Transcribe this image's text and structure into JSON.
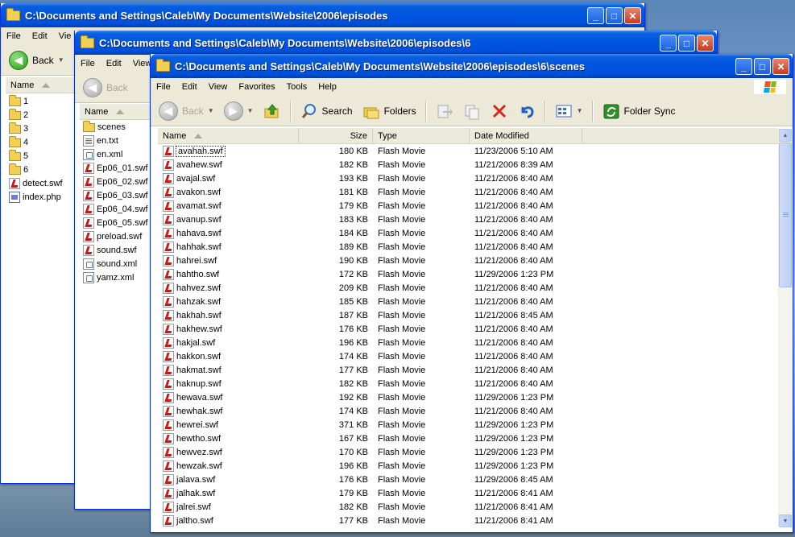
{
  "window1": {
    "title": "C:\\Documents and Settings\\Caleb\\My Documents\\Website\\2006\\episodes",
    "menu": [
      "File",
      "Edit",
      "Vie"
    ],
    "back_label": "Back",
    "name_header": "Name",
    "items": [
      {
        "name": "1",
        "icon": "folder"
      },
      {
        "name": "2",
        "icon": "folder"
      },
      {
        "name": "3",
        "icon": "folder"
      },
      {
        "name": "4",
        "icon": "folder"
      },
      {
        "name": "5",
        "icon": "folder"
      },
      {
        "name": "6",
        "icon": "folder"
      },
      {
        "name": "detect.swf",
        "icon": "swf"
      },
      {
        "name": "index.php",
        "icon": "php"
      }
    ]
  },
  "window2": {
    "title": "C:\\Documents and Settings\\Caleb\\My Documents\\Website\\2006\\episodes\\6",
    "menu": [
      "File",
      "Edit",
      "View"
    ],
    "back_label": "Back",
    "name_header": "Name",
    "items": [
      {
        "name": "scenes",
        "icon": "folder"
      },
      {
        "name": "en.txt",
        "icon": "txt"
      },
      {
        "name": "en.xml",
        "icon": "xml"
      },
      {
        "name": "Ep06_01.swf",
        "icon": "swf"
      },
      {
        "name": "Ep06_02.swf",
        "icon": "swf"
      },
      {
        "name": "Ep06_03.swf",
        "icon": "swf"
      },
      {
        "name": "Ep06_04.swf",
        "icon": "swf"
      },
      {
        "name": "Ep06_05.swf",
        "icon": "swf"
      },
      {
        "name": "preload.swf",
        "icon": "swf"
      },
      {
        "name": "sound.swf",
        "icon": "swf"
      },
      {
        "name": "sound.xml",
        "icon": "xml"
      },
      {
        "name": "yamz.xml",
        "icon": "xml"
      }
    ]
  },
  "window3": {
    "title": "C:\\Documents and Settings\\Caleb\\My Documents\\Website\\2006\\episodes\\6\\scenes",
    "menu": [
      "File",
      "Edit",
      "View",
      "Favorites",
      "Tools",
      "Help"
    ],
    "toolbar": {
      "back": "Back",
      "search": "Search",
      "folders": "Folders",
      "folder_sync": "Folder Sync"
    },
    "columns": {
      "name": "Name",
      "size": "Size",
      "type": "Type",
      "date": "Date Modified"
    },
    "files": [
      {
        "name": "avahah.swf",
        "size": "180 KB",
        "type": "Flash Movie",
        "date": "11/23/2006 5:10 AM"
      },
      {
        "name": "avahew.swf",
        "size": "182 KB",
        "type": "Flash Movie",
        "date": "11/21/2006 8:39 AM"
      },
      {
        "name": "avajal.swf",
        "size": "193 KB",
        "type": "Flash Movie",
        "date": "11/21/2006 8:40 AM"
      },
      {
        "name": "avakon.swf",
        "size": "181 KB",
        "type": "Flash Movie",
        "date": "11/21/2006 8:40 AM"
      },
      {
        "name": "avamat.swf",
        "size": "179 KB",
        "type": "Flash Movie",
        "date": "11/21/2006 8:40 AM"
      },
      {
        "name": "avanup.swf",
        "size": "183 KB",
        "type": "Flash Movie",
        "date": "11/21/2006 8:40 AM"
      },
      {
        "name": "hahava.swf",
        "size": "184 KB",
        "type": "Flash Movie",
        "date": "11/21/2006 8:40 AM"
      },
      {
        "name": "hahhak.swf",
        "size": "189 KB",
        "type": "Flash Movie",
        "date": "11/21/2006 8:40 AM"
      },
      {
        "name": "hahrei.swf",
        "size": "190 KB",
        "type": "Flash Movie",
        "date": "11/21/2006 8:40 AM"
      },
      {
        "name": "hahtho.swf",
        "size": "172 KB",
        "type": "Flash Movie",
        "date": "11/29/2006 1:23 PM"
      },
      {
        "name": "hahvez.swf",
        "size": "209 KB",
        "type": "Flash Movie",
        "date": "11/21/2006 8:40 AM"
      },
      {
        "name": "hahzak.swf",
        "size": "185 KB",
        "type": "Flash Movie",
        "date": "11/21/2006 8:40 AM"
      },
      {
        "name": "hakhah.swf",
        "size": "187 KB",
        "type": "Flash Movie",
        "date": "11/21/2006 8:45 AM"
      },
      {
        "name": "hakhew.swf",
        "size": "176 KB",
        "type": "Flash Movie",
        "date": "11/21/2006 8:40 AM"
      },
      {
        "name": "hakjal.swf",
        "size": "196 KB",
        "type": "Flash Movie",
        "date": "11/21/2006 8:40 AM"
      },
      {
        "name": "hakkon.swf",
        "size": "174 KB",
        "type": "Flash Movie",
        "date": "11/21/2006 8:40 AM"
      },
      {
        "name": "hakmat.swf",
        "size": "177 KB",
        "type": "Flash Movie",
        "date": "11/21/2006 8:40 AM"
      },
      {
        "name": "haknup.swf",
        "size": "182 KB",
        "type": "Flash Movie",
        "date": "11/21/2006 8:40 AM"
      },
      {
        "name": "hewava.swf",
        "size": "192 KB",
        "type": "Flash Movie",
        "date": "11/29/2006 1:23 PM"
      },
      {
        "name": "hewhak.swf",
        "size": "174 KB",
        "type": "Flash Movie",
        "date": "11/21/2006 8:40 AM"
      },
      {
        "name": "hewrei.swf",
        "size": "371 KB",
        "type": "Flash Movie",
        "date": "11/29/2006 1:23 PM"
      },
      {
        "name": "hewtho.swf",
        "size": "167 KB",
        "type": "Flash Movie",
        "date": "11/29/2006 1:23 PM"
      },
      {
        "name": "hewvez.swf",
        "size": "170 KB",
        "type": "Flash Movie",
        "date": "11/29/2006 1:23 PM"
      },
      {
        "name": "hewzak.swf",
        "size": "196 KB",
        "type": "Flash Movie",
        "date": "11/29/2006 1:23 PM"
      },
      {
        "name": "jalava.swf",
        "size": "176 KB",
        "type": "Flash Movie",
        "date": "11/29/2006 8:45 AM"
      },
      {
        "name": "jalhak.swf",
        "size": "179 KB",
        "type": "Flash Movie",
        "date": "11/21/2006 8:41 AM"
      },
      {
        "name": "jalrei.swf",
        "size": "182 KB",
        "type": "Flash Movie",
        "date": "11/21/2006 8:41 AM"
      },
      {
        "name": "jaltho.swf",
        "size": "177 KB",
        "type": "Flash Movie",
        "date": "11/21/2006 8:41 AM"
      }
    ]
  }
}
